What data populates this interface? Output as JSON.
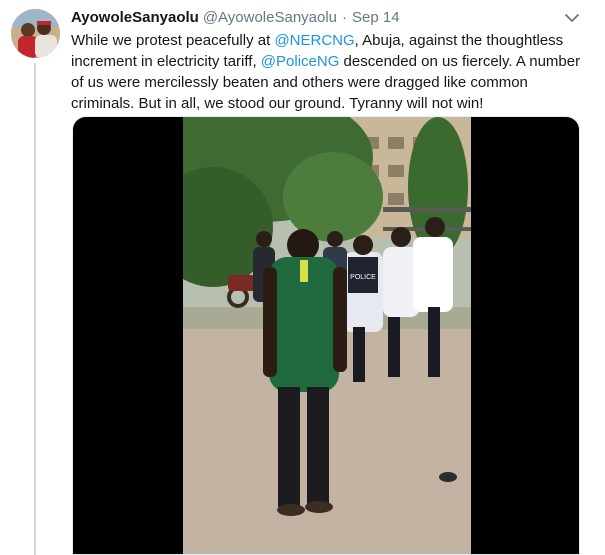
{
  "tweet": {
    "display_name": "AyowoleSanyaolu",
    "handle": "@AyowoleSanyaolu",
    "separator": "·",
    "date": "Sep 14",
    "text_parts": [
      "While we protest peacefully at ",
      "@NERCNG",
      ", Abuja, against the thoughtless increment in electricity tariff, ",
      "@PoliceNG",
      " descended on us fiercely. A number of us were mercilessly beaten and others were dragged like common criminals. But in all, we stood our ground. Tyranny will not win!"
    ]
  },
  "media": {
    "police_label": "POLICE"
  },
  "colors": {
    "link": "#1b95e0",
    "text": "#14171a",
    "muted": "#657786",
    "thread_line": "#ccd6dd"
  }
}
